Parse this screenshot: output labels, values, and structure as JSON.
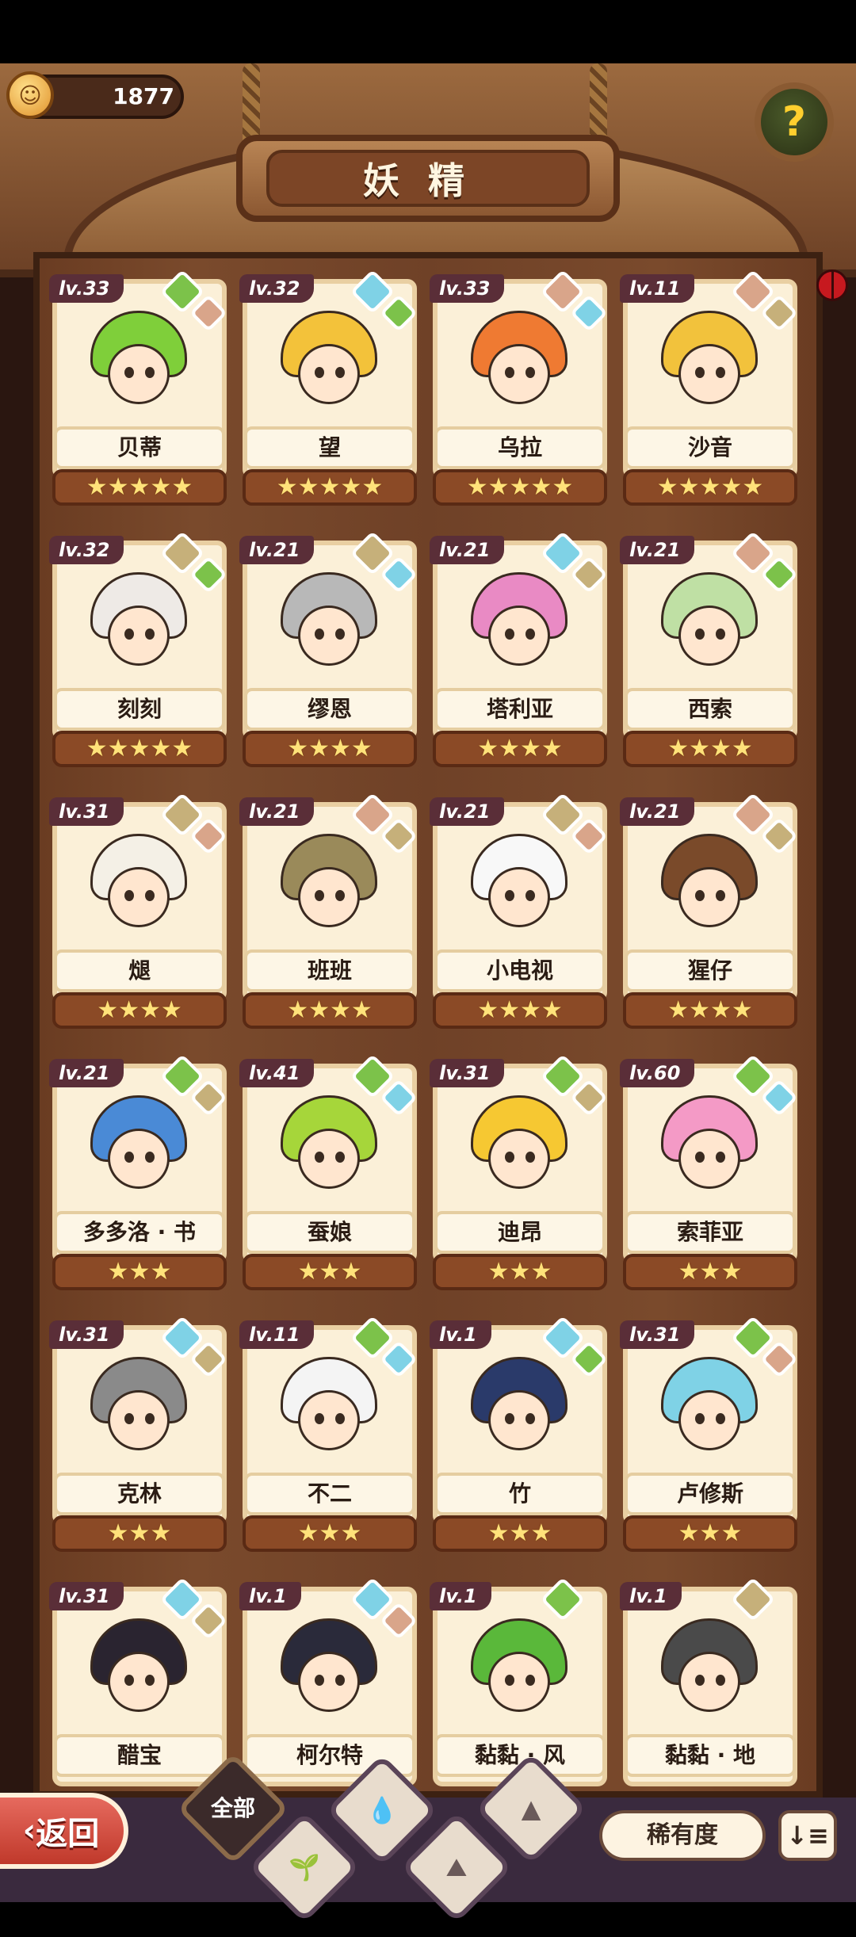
{
  "header": {
    "title": "妖精",
    "coins": "1877",
    "help_label": "?"
  },
  "colors": {
    "leaf": "#7cc24a",
    "water": "#7fd2e6",
    "earth": "#c6b07a",
    "mountain": "#d9a58a",
    "level_bg": "#5a2e38",
    "star": "#ffe27a"
  },
  "fairies": [
    {
      "level": "lv.33",
      "name": "贝蒂",
      "stars": "★★★★★",
      "badges": [
        "leaf-icon",
        "mountain-icon"
      ],
      "hair": "#7fcf3a"
    },
    {
      "level": "lv.32",
      "name": "望",
      "stars": "★★★★★",
      "badges": [
        "water-icon",
        "leaf-icon"
      ],
      "hair": "#f3c23a"
    },
    {
      "level": "lv.33",
      "name": "乌拉",
      "stars": "★★★★★",
      "badges": [
        "mountain-icon",
        "water-icon"
      ],
      "hair": "#ef7a32"
    },
    {
      "level": "lv.11",
      "name": "沙音",
      "stars": "★★★★★",
      "badges": [
        "mountain-icon",
        "earth-icon"
      ],
      "hair": "#f2c23c"
    },
    {
      "level": "lv.32",
      "name": "刻刻",
      "stars": "★★★★★",
      "badges": [
        "earth-icon",
        "leaf-icon"
      ],
      "hair": "#eeeae6"
    },
    {
      "level": "lv.21",
      "name": "缪恩",
      "stars": "★★★★",
      "badges": [
        "earth-icon",
        "water-icon"
      ],
      "hair": "#b8b8b8"
    },
    {
      "level": "lv.21",
      "name": "塔利亚",
      "stars": "★★★★",
      "badges": [
        "water-icon",
        "earth-icon"
      ],
      "hair": "#e98ac4"
    },
    {
      "level": "lv.21",
      "name": "西索",
      "stars": "★★★★",
      "badges": [
        "mountain-icon",
        "leaf-icon"
      ],
      "hair": "#bfe0a4"
    },
    {
      "level": "lv.31",
      "name": "煺",
      "stars": "★★★★",
      "badges": [
        "earth-icon",
        "mountain-icon"
      ],
      "hair": "#f4f0e6"
    },
    {
      "level": "lv.21",
      "name": "班班",
      "stars": "★★★★",
      "badges": [
        "mountain-icon",
        "earth-icon"
      ],
      "hair": "#9a8a5a"
    },
    {
      "level": "lv.21",
      "name": "小电视",
      "stars": "★★★★",
      "badges": [
        "earth-icon",
        "mountain-icon"
      ],
      "hair": "#f8f8f8"
    },
    {
      "level": "lv.21",
      "name": "猩仔",
      "stars": "★★★★",
      "badges": [
        "mountain-icon",
        "earth-icon"
      ],
      "hair": "#7a4a2a"
    },
    {
      "level": "lv.21",
      "name": "多多洛 · 书",
      "stars": "★★★",
      "badges": [
        "leaf-icon",
        "earth-icon"
      ],
      "hair": "#4a8ad6"
    },
    {
      "level": "lv.41",
      "name": "蚕娘",
      "stars": "★★★",
      "badges": [
        "leaf-icon",
        "water-icon"
      ],
      "hair": "#a6d63a"
    },
    {
      "level": "lv.31",
      "name": "迪昂",
      "stars": "★★★",
      "badges": [
        "leaf-icon",
        "earth-icon"
      ],
      "hair": "#f6c832"
    },
    {
      "level": "lv.60",
      "name": "索菲亚",
      "stars": "★★★",
      "badges": [
        "leaf-icon",
        "water-icon"
      ],
      "hair": "#f49ac6"
    },
    {
      "level": "lv.31",
      "name": "克林",
      "stars": "★★★",
      "badges": [
        "water-icon",
        "earth-icon"
      ],
      "hair": "#8a8a8a"
    },
    {
      "level": "lv.11",
      "name": "不二",
      "stars": "★★★",
      "badges": [
        "leaf-icon",
        "water-icon"
      ],
      "hair": "#f4f4f4"
    },
    {
      "level": "lv.1",
      "name": "竹",
      "stars": "★★★",
      "badges": [
        "water-icon",
        "leaf-icon"
      ],
      "hair": "#2a3a6a"
    },
    {
      "level": "lv.31",
      "name": "卢修斯",
      "stars": "★★★",
      "badges": [
        "leaf-icon",
        "mountain-icon"
      ],
      "hair": "#7fd2e6"
    },
    {
      "level": "lv.31",
      "name": "醋宝",
      "stars": "",
      "badges": [
        "water-icon",
        "earth-icon"
      ],
      "hair": "#2a2430"
    },
    {
      "level": "lv.1",
      "name": "柯尔特",
      "stars": "",
      "badges": [
        "water-icon",
        "mountain-icon"
      ],
      "hair": "#2a2a3a"
    },
    {
      "level": "lv.1",
      "name": "黏黏 · 风",
      "stars": "",
      "badges": [
        "leaf-icon"
      ],
      "hair": "#5ab83a"
    },
    {
      "level": "lv.1",
      "name": "黏黏 · 地",
      "stars": "",
      "badges": [
        "earth-icon"
      ],
      "hair": "#4a4a4a"
    }
  ],
  "footer": {
    "back_label": "返回",
    "all_label": "全部",
    "rarity_label": "稀有度",
    "sort_label": "↓≡"
  }
}
